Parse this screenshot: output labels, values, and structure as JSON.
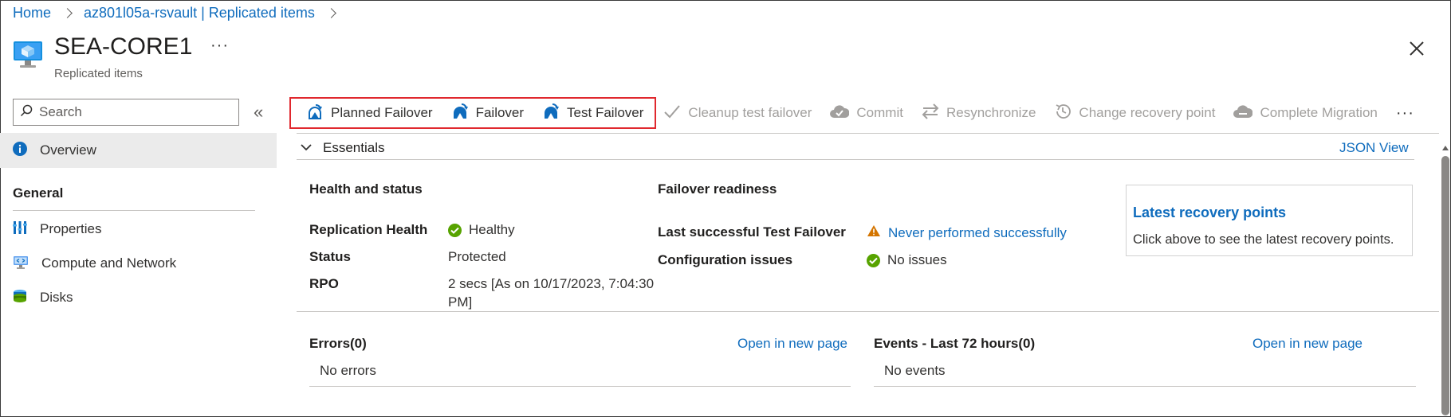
{
  "breadcrumb": [
    "Home",
    "az801l05a-rsvault | Replicated items"
  ],
  "header": {
    "title": "SEA-CORE1",
    "subtitle": "Replicated items",
    "more": "···"
  },
  "sidebar": {
    "search_placeholder": "Search",
    "collapse": "«",
    "overview": "Overview",
    "section_general": "General",
    "items": [
      "Properties",
      "Compute and Network",
      "Disks"
    ]
  },
  "toolbar": {
    "planned_failover": "Planned Failover",
    "failover": "Failover",
    "test_failover": "Test Failover",
    "cleanup": "Cleanup test failover",
    "commit": "Commit",
    "resynchronize": "Resynchronize",
    "change_recovery": "Change recovery point",
    "complete_migration": "Complete Migration",
    "more": "···"
  },
  "essentials": {
    "label": "Essentials",
    "json_view": "JSON View",
    "health_heading": "Health and status",
    "replication_health_label": "Replication Health",
    "replication_health_value": "Healthy",
    "status_label": "Status",
    "status_value": "Protected",
    "rpo_label": "RPO",
    "rpo_value_line1": "2 secs [As on 10/17/2023, 7:04:30",
    "rpo_value_line2": "PM]",
    "failover_heading": "Failover readiness",
    "last_test_label": "Last successful Test Failover",
    "last_test_value": "Never performed successfully",
    "config_label": "Configuration issues",
    "config_value": "No issues",
    "recovery_title": "Latest recovery points",
    "recovery_desc": "Click above to see the latest recovery points."
  },
  "errors": {
    "title": "Errors(0)",
    "open": "Open in new page",
    "empty": "No errors"
  },
  "events": {
    "title": "Events - Last 72 hours(0)",
    "open": "Open in new page",
    "empty": "No events"
  },
  "colors": {
    "link": "#0f6cbd",
    "highlight": "#e0282e",
    "healthy": "#57a300",
    "warning": "#d47500"
  }
}
